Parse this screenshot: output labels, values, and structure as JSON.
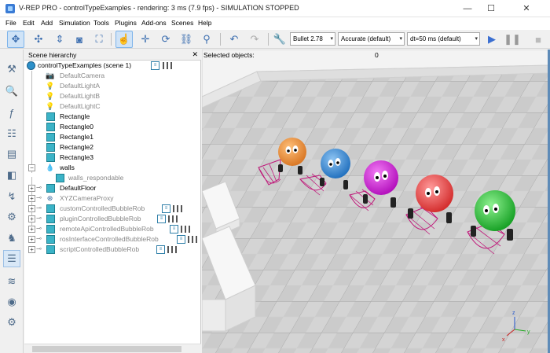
{
  "window": {
    "title": "V-REP PRO - controlTypeExamples - rendering: 3 ms (7.9 fps) - SIMULATION STOPPED",
    "minimize": "—",
    "maximize": "☐",
    "close": "✕"
  },
  "menu": [
    "File",
    "Edit",
    "Add",
    "Simulation",
    "Tools",
    "Plugins",
    "Add-ons",
    "Scenes",
    "Help"
  ],
  "toolbar": {
    "engine": "Bullet 2.78",
    "accuracy": "Accurate (default)",
    "timestep": "dt=50 ms (default)"
  },
  "hierarchy": {
    "title": "Scene hierarchy",
    "close": "✕",
    "scene": "controlTypeExamples (scene 1)",
    "items": [
      "DefaultCamera",
      "DefaultLightA",
      "DefaultLightB",
      "DefaultLightC",
      "Rectangle",
      "Rectangle0",
      "Rectangle1",
      "Rectangle2",
      "Rectangle3",
      "walls",
      "walls_respondable",
      "DefaultFloor",
      "XYZCameraProxy",
      "customControlledBubbleRob",
      "pluginControlledBubbleRob",
      "remoteApiControlledBubbleRob",
      "rosInterfaceControlledBubbleRob",
      "scriptControlledBubbleRob"
    ]
  },
  "viewport": {
    "selected_label": "Selected objects:",
    "selected_count": "0",
    "axis_x": "x",
    "axis_y": "y",
    "axis_z": "z"
  },
  "colors": {
    "robot_orange": "#e8903a",
    "robot_blue": "#3a88d0",
    "robot_magenta": "#d22ad6",
    "robot_red": "#e84a4a",
    "robot_green": "#2dbb3a",
    "sensor_cone": "#c0187a",
    "floor": "#c9c9c9",
    "wall": "#f2f2f2"
  }
}
